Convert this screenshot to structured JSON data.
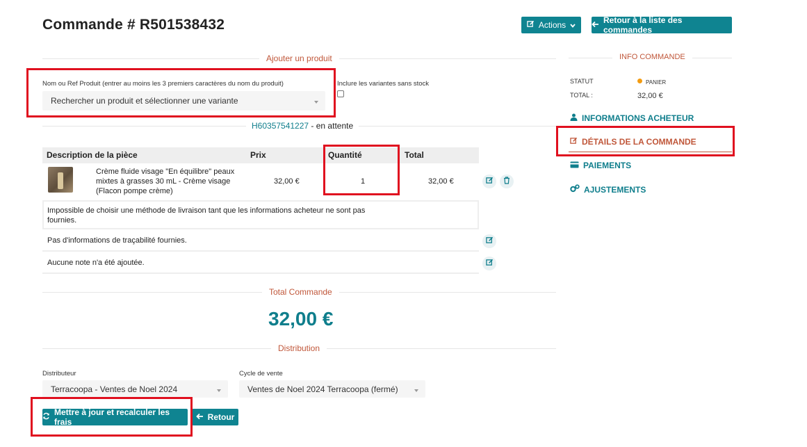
{
  "header": {
    "title": "Commande # R501538432",
    "actions_label": "Actions",
    "back_to_list_label": "Retour à la liste des commandes"
  },
  "add_product": {
    "section_title": "Ajouter un produit",
    "search_label": "Nom ou Ref Produit (entrer au moins les 3 premiers caractères du nom du produit)",
    "search_placeholder": "Rechercher un produit et sélectionner une variante",
    "include_variants_label": "Inclure les variantes sans stock",
    "include_variants_checked": false
  },
  "shipment": {
    "number": "H60357541227",
    "status": "- en attente"
  },
  "items_table": {
    "headers": [
      "Description de la pièce",
      "Prix",
      "Quantité",
      "Total"
    ],
    "rows": [
      {
        "description": "Crème fluide visage \"En équilibre\" peaux mixtes à grasses 30 mL - Crème visage (Flacon pompe crème)",
        "price": "32,00 €",
        "quantity": "1",
        "total": "32,00 €"
      }
    ]
  },
  "notices": {
    "shipping": "Impossible de choisir une méthode de livraison tant que les informations acheteur ne sont pas fournies.",
    "traceability": "Pas d'informations de traçabilité fournies.",
    "note": "Aucune note n'a été ajoutée."
  },
  "order_total": {
    "section_title": "Total Commande",
    "value": "32,00 €"
  },
  "distribution": {
    "section_title": "Distribution",
    "distributor_label": "Distributeur",
    "distributor_value": "Terracoopa - Ventes de Noel 2024",
    "cycle_label": "Cycle de vente",
    "cycle_value": "Ventes de Noel 2024 Terracoopa (fermé)"
  },
  "footer_buttons": {
    "update_label": "Mettre à jour et recalculer les frais",
    "back_label": "Retour"
  },
  "sidebar": {
    "info_title": "INFO COMMANDE",
    "status_label": "STATUT",
    "status_value": "PANIER",
    "status_color": "#f39c12",
    "total_label": "TOTAL :",
    "total_value": "32,00 €",
    "links": [
      {
        "label": "Informations acheteur",
        "icon": "user-icon"
      },
      {
        "label": "Détails de la commande",
        "icon": "edit-icon"
      },
      {
        "label": "Paiements",
        "icon": "credit-card-icon"
      },
      {
        "label": "Ajustements",
        "icon": "cogs-icon"
      }
    ]
  },
  "colors": {
    "accent": "#0f8491",
    "section_title": "#c0573a",
    "highlight": "#e0101f"
  }
}
